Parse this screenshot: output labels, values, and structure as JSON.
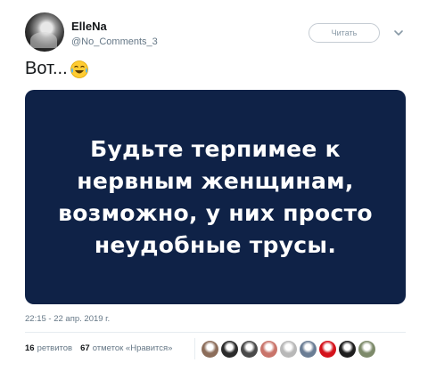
{
  "author": {
    "name": "ElleNa",
    "handle": "@No_Comments_3"
  },
  "follow_button_label": "Читать",
  "tweet": {
    "text": "Вот...",
    "emoji": "face-with-tears-of-joy-icon"
  },
  "media": {
    "text": "Будьте терпимее к\nнервным женщинам,\nвозможно, у них просто\nнеудобные трусы.",
    "background": "#0f2247"
  },
  "timestamp": "22:15 - 22 апр. 2019 г.",
  "stats": {
    "retweets_count": "16",
    "retweets_label": "ретвитов",
    "likes_count": "67",
    "likes_label": "отметок «Нравится»"
  },
  "likers": [
    {
      "icon": "avatar-1",
      "color": "#8c6d5a"
    },
    {
      "icon": "avatar-2",
      "color": "#2b2b2b"
    },
    {
      "icon": "avatar-3",
      "color": "#4a4a4a"
    },
    {
      "icon": "avatar-4",
      "color": "#c9746a"
    },
    {
      "icon": "avatar-5",
      "color": "#b8b8b8"
    },
    {
      "icon": "avatar-6",
      "color": "#6a7d94"
    },
    {
      "icon": "avatar-7",
      "color": "#d4121b"
    },
    {
      "icon": "avatar-8",
      "color": "#1e1e1e"
    },
    {
      "icon": "avatar-9",
      "color": "#7d8a6a"
    }
  ]
}
